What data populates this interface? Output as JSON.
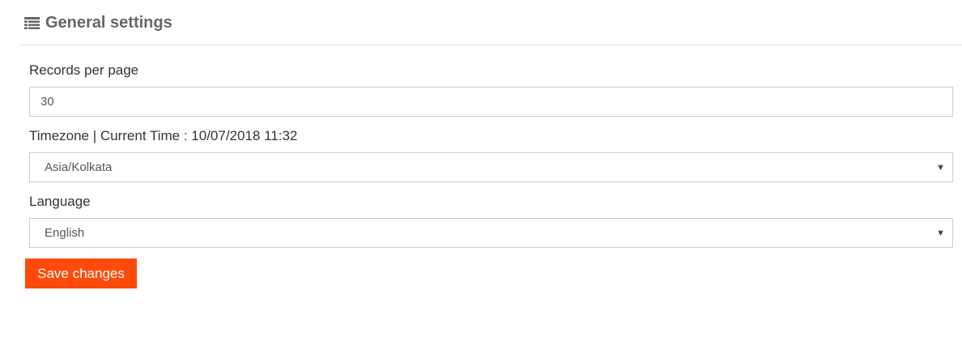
{
  "header": {
    "icon": "list-icon",
    "title": "General settings"
  },
  "records_per_page": {
    "label": "Records per page",
    "value": "30"
  },
  "timezone": {
    "label": "Timezone | Current Time : 10/07/2018 11:32",
    "selected": "Asia/Kolkata"
  },
  "language": {
    "label": "Language",
    "selected": "English"
  },
  "actions": {
    "save_label": "Save changes"
  },
  "colors": {
    "accent": "#ff4a0a",
    "title": "#666666",
    "border": "#cccccc"
  }
}
